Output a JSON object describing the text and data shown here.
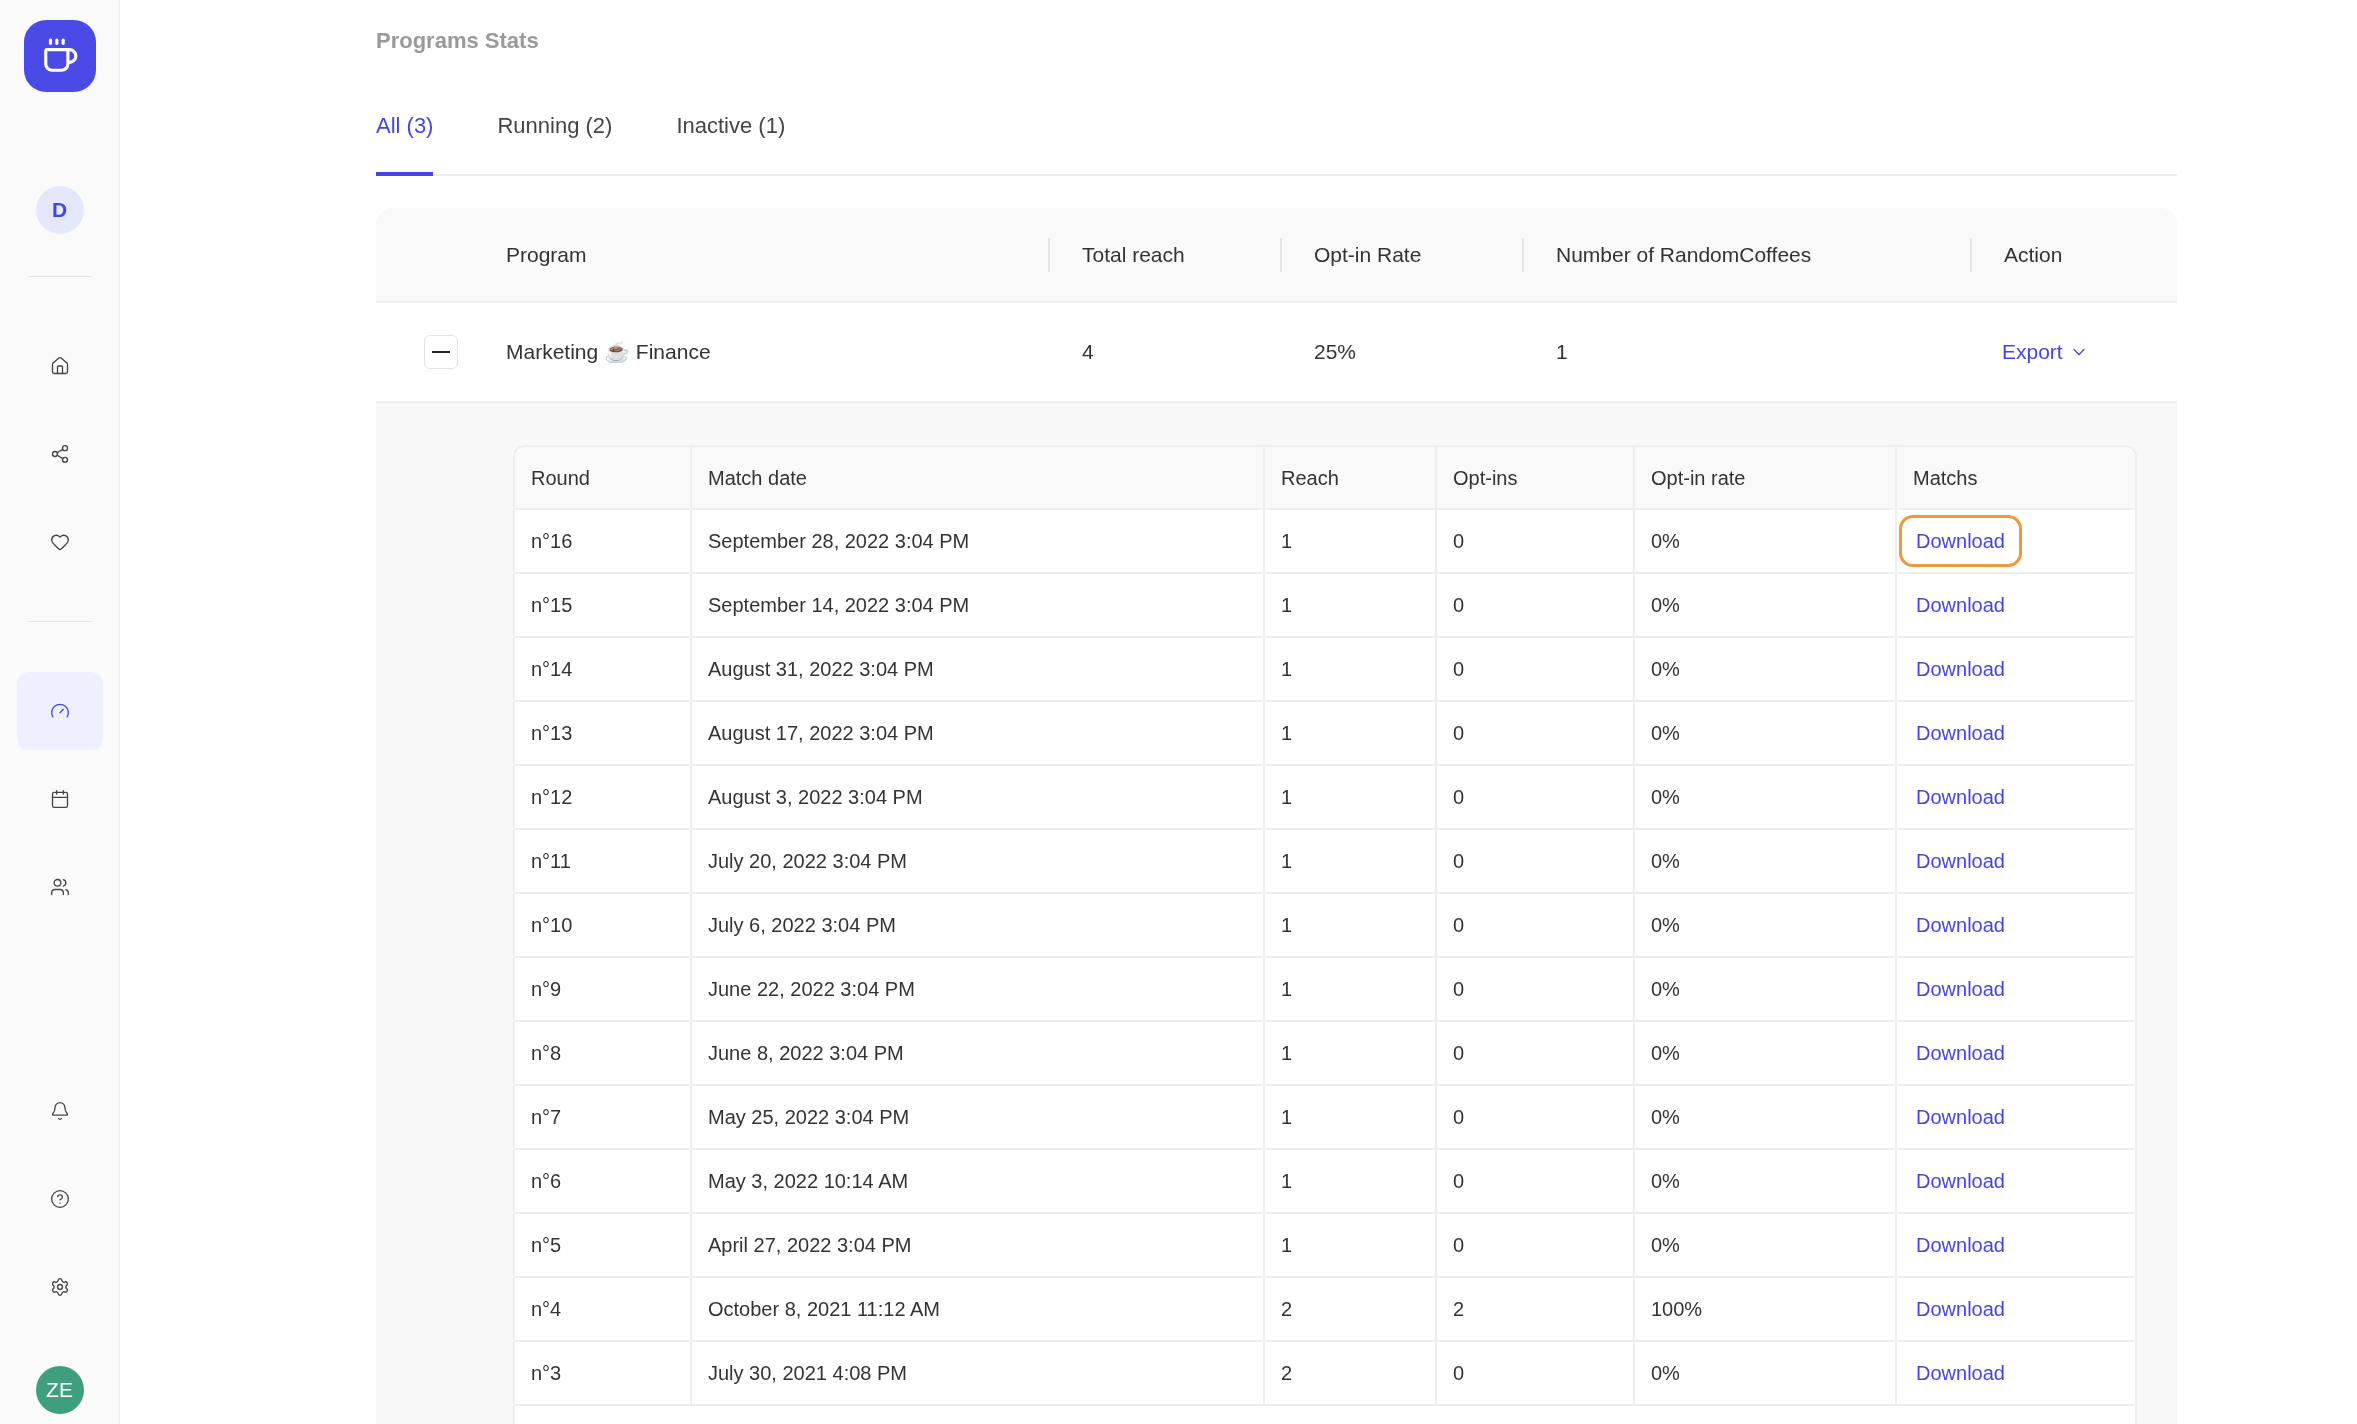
{
  "sidebar": {
    "user_initial": "D",
    "nav_top": [
      {
        "selected": false
      },
      {
        "selected": false
      },
      {
        "selected": false
      }
    ],
    "nav_main": [
      {
        "selected": true
      },
      {
        "selected": false
      },
      {
        "selected": false
      }
    ],
    "nav_bottom": [
      {
        "selected": false
      },
      {
        "selected": false
      },
      {
        "selected": false
      }
    ],
    "account_initials": "ZE"
  },
  "title": "Programs Stats",
  "tabs": [
    {
      "label": "All (3)",
      "selected": true
    },
    {
      "label": "Running (2)",
      "selected": false
    },
    {
      "label": "Inactive (1)",
      "selected": false
    }
  ],
  "programs_table": {
    "columns": [
      "Program",
      "Total reach",
      "Opt-in Rate",
      "Number of RandomCoffees",
      "Action"
    ],
    "rows": [
      {
        "expanded": true,
        "program": "Marketing ☕ Finance",
        "total_reach": "4",
        "opt_in_rate": "25%",
        "randomcoffees": "1",
        "action": "Export",
        "rounds": {
          "columns": [
            "Round",
            "Match date",
            "Reach",
            "Opt-ins",
            "Opt-in rate",
            "Matchs"
          ],
          "rows": [
            {
              "round": "n°16",
              "date": "September 28, 2022 3:04 PM",
              "reach": "1",
              "opt_ins": "0",
              "rate": "0%",
              "link": "Download",
              "highlighted": true
            },
            {
              "round": "n°15",
              "date": "September 14, 2022 3:04 PM",
              "reach": "1",
              "opt_ins": "0",
              "rate": "0%",
              "link": "Download",
              "highlighted": false
            },
            {
              "round": "n°14",
              "date": "August 31, 2022 3:04 PM",
              "reach": "1",
              "opt_ins": "0",
              "rate": "0%",
              "link": "Download",
              "highlighted": false
            },
            {
              "round": "n°13",
              "date": "August 17, 2022 3:04 PM",
              "reach": "1",
              "opt_ins": "0",
              "rate": "0%",
              "link": "Download",
              "highlighted": false
            },
            {
              "round": "n°12",
              "date": "August 3, 2022 3:04 PM",
              "reach": "1",
              "opt_ins": "0",
              "rate": "0%",
              "link": "Download",
              "highlighted": false
            },
            {
              "round": "n°11",
              "date": "July 20, 2022 3:04 PM",
              "reach": "1",
              "opt_ins": "0",
              "rate": "0%",
              "link": "Download",
              "highlighted": false
            },
            {
              "round": "n°10",
              "date": "July 6, 2022 3:04 PM",
              "reach": "1",
              "opt_ins": "0",
              "rate": "0%",
              "link": "Download",
              "highlighted": false
            },
            {
              "round": "n°9",
              "date": "June 22, 2022 3:04 PM",
              "reach": "1",
              "opt_ins": "0",
              "rate": "0%",
              "link": "Download",
              "highlighted": false
            },
            {
              "round": "n°8",
              "date": "June 8, 2022 3:04 PM",
              "reach": "1",
              "opt_ins": "0",
              "rate": "0%",
              "link": "Download",
              "highlighted": false
            },
            {
              "round": "n°7",
              "date": "May 25, 2022 3:04 PM",
              "reach": "1",
              "opt_ins": "0",
              "rate": "0%",
              "link": "Download",
              "highlighted": false
            },
            {
              "round": "n°6",
              "date": "May 3, 2022 10:14 AM",
              "reach": "1",
              "opt_ins": "0",
              "rate": "0%",
              "link": "Download",
              "highlighted": false
            },
            {
              "round": "n°5",
              "date": "April 27, 2022 3:04 PM",
              "reach": "1",
              "opt_ins": "0",
              "rate": "0%",
              "link": "Download",
              "highlighted": false
            },
            {
              "round": "n°4",
              "date": "October 8, 2021 11:12 AM",
              "reach": "2",
              "opt_ins": "2",
              "rate": "100%",
              "link": "Download",
              "highlighted": false
            },
            {
              "round": "n°3",
              "date": "July 30, 2021 4:08 PM",
              "reach": "2",
              "opt_ins": "0",
              "rate": "0%",
              "link": "Download",
              "highlighted": false
            }
          ]
        }
      }
    ]
  }
}
